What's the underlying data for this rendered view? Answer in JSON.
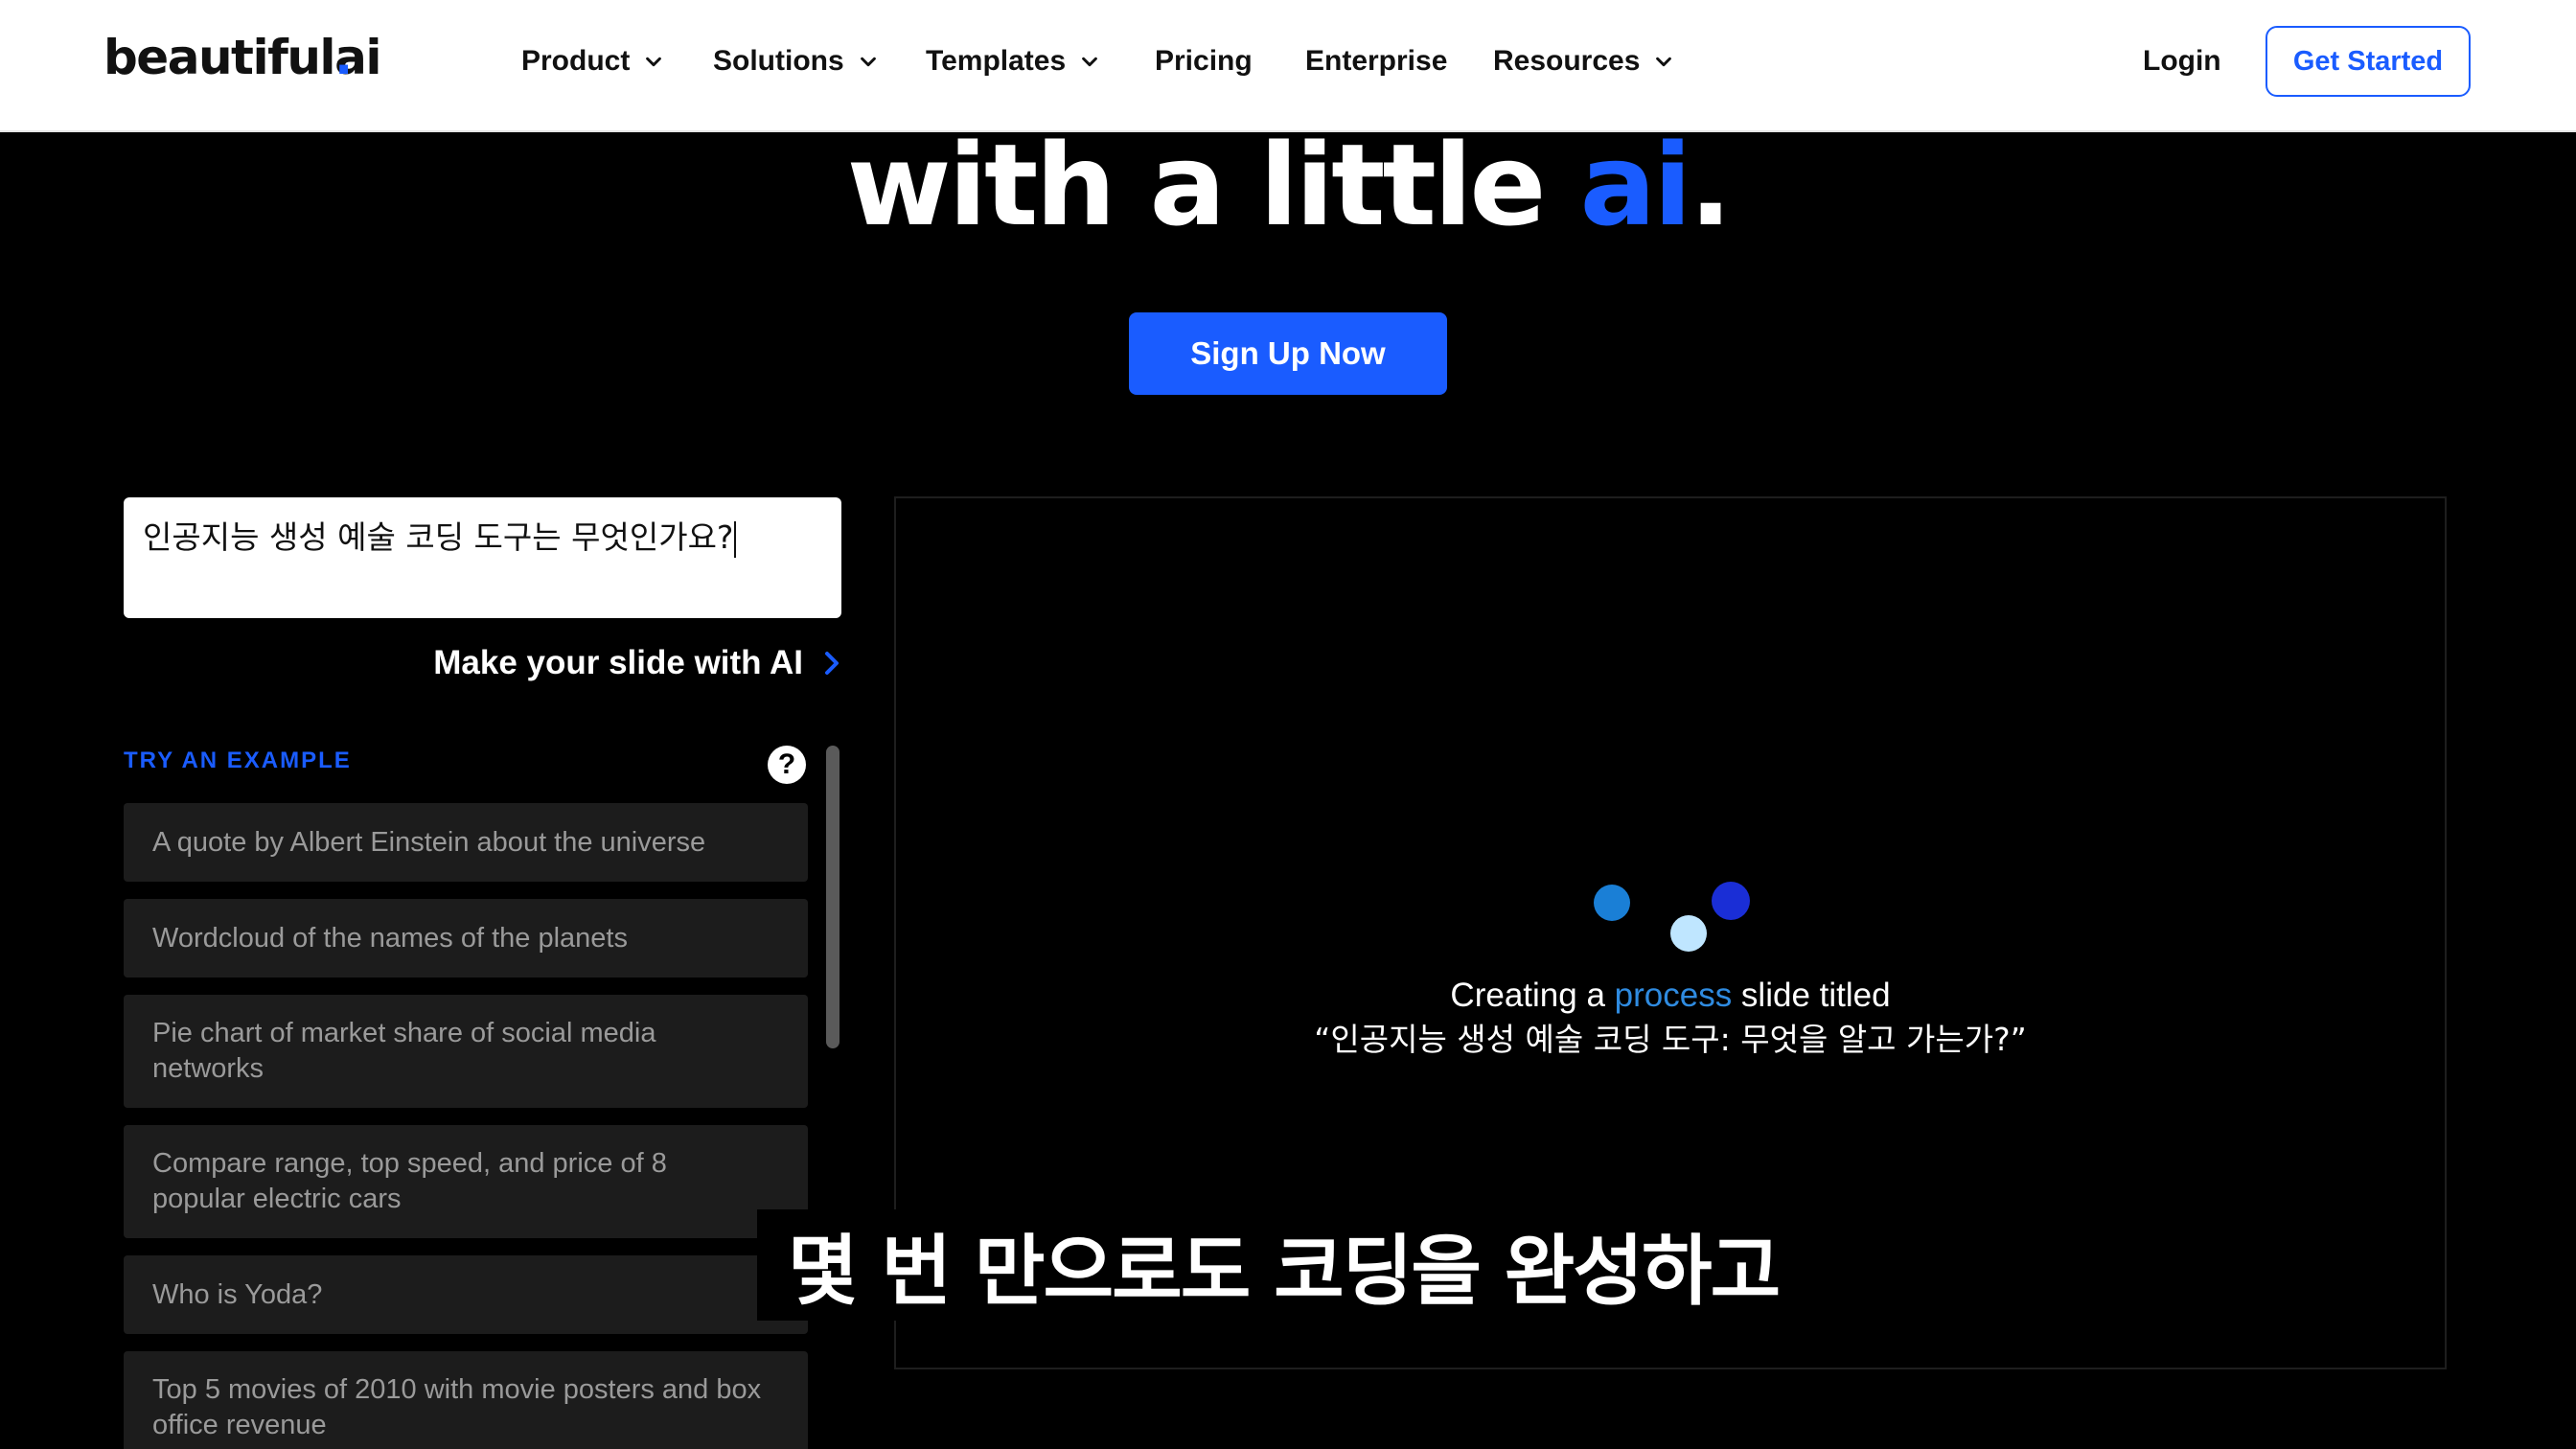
{
  "nav": {
    "logo_main": "beautiful",
    "logo_dot": ".",
    "logo_suffix": "ai",
    "items": [
      {
        "label": "Product"
      },
      {
        "label": "Solutions"
      },
      {
        "label": "Templates"
      },
      {
        "label": "Pricing"
      },
      {
        "label": "Enterprise"
      },
      {
        "label": "Resources"
      }
    ],
    "login": "Login",
    "get_started": "Get Started"
  },
  "hero": {
    "title_pre": "with a little ",
    "title_ai": "ai",
    "title_post": ".",
    "signup": "Sign Up Now"
  },
  "prompt": {
    "value": "인공지능 생성 예술 코딩 도구는 무엇인가요?",
    "make_slide": "Make your slide with AI"
  },
  "examples": {
    "label": "TRY AN EXAMPLE",
    "help": "?",
    "items": [
      "A quote by Albert Einstein about the universe",
      "Wordcloud of the names of the planets",
      "Pie chart of market share of social media networks",
      "Compare range, top speed, and price of 8 popular electric cars",
      "Who is Yoda?",
      "Top 5 movies of 2010 with movie posters and box office revenue"
    ]
  },
  "preview": {
    "status_pre": "Creating a ",
    "status_keyword": "process",
    "status_post": " slide titled",
    "status_title": "“인공지능 생성 예술 코딩 도구: 무엇을 알고 가는가?”",
    "loader_colors": [
      "#1a7fd6",
      "#1a2ed6",
      "#bfe6ff"
    ]
  },
  "caption": "몇 번 만으로도 코딩을 완성하고",
  "colors": {
    "accent": "#1a5cff",
    "keyword": "#2f8be0",
    "example_bg": "#1c1c1c"
  }
}
